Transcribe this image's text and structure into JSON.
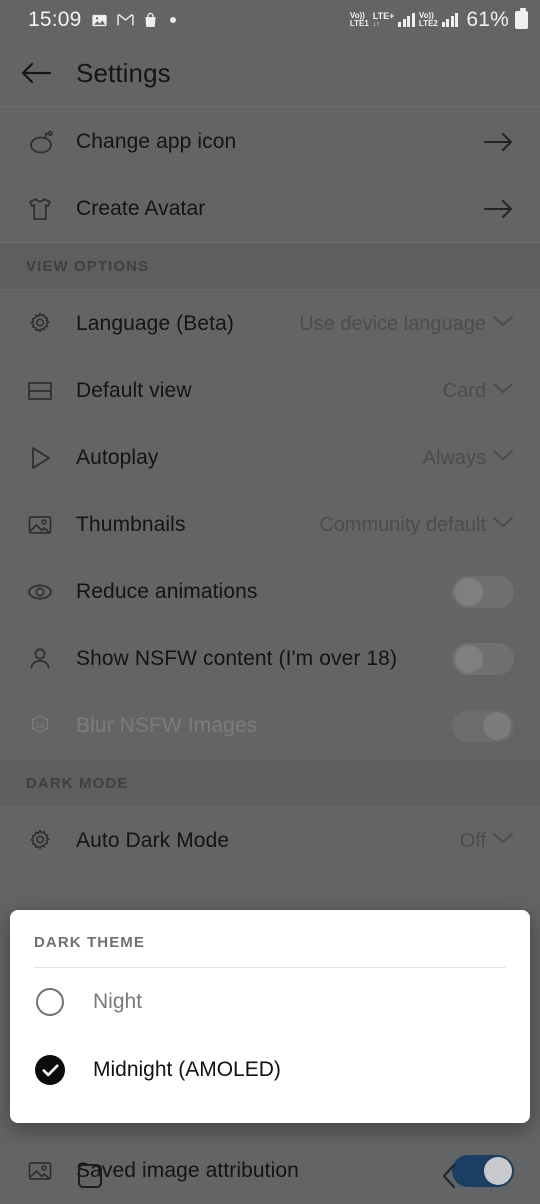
{
  "status_bar": {
    "clock": "15:09",
    "icons": [
      "photos-icon",
      "gmail-icon",
      "shopping-bag-icon",
      "dot-icon"
    ],
    "network": {
      "volte1_line1": "Vo))",
      "volte1_line2": "LTE1",
      "lte_plus": "LTE+",
      "data_arrows": "↓↑",
      "volte2_line1": "Vo))",
      "volte2_line2": "LTE2"
    },
    "battery_percent": "61%"
  },
  "app_bar": {
    "title": "Settings",
    "back_icon": "back-arrow-icon"
  },
  "settings": {
    "top_rows": [
      {
        "icon": "reddit-snoo-icon",
        "label": "Change app icon",
        "trailing": "arrow-right-icon"
      },
      {
        "icon": "tshirt-icon",
        "label": "Create Avatar",
        "trailing": "arrow-right-icon"
      }
    ],
    "view_options": {
      "header": "VIEW OPTIONS",
      "rows": [
        {
          "icon": "gear-icon",
          "label": "Language (Beta)",
          "value": "Use device language",
          "control": "dropdown"
        },
        {
          "icon": "card-view-icon",
          "label": "Default view",
          "value": "Card",
          "control": "dropdown"
        },
        {
          "icon": "play-icon",
          "label": "Autoplay",
          "value": "Always",
          "control": "dropdown"
        },
        {
          "icon": "image-icon",
          "label": "Thumbnails",
          "value": "Community default",
          "control": "dropdown"
        },
        {
          "icon": "eye-icon",
          "label": "Reduce animations",
          "value": "",
          "control": "toggle-off"
        },
        {
          "icon": "person-icon",
          "label": "Show NSFW content (I'm over 18)",
          "value": "",
          "control": "toggle-off"
        },
        {
          "icon": "age-18-icon",
          "label": "Blur NSFW Images",
          "value": "",
          "control": "toggle-on-disabled"
        }
      ]
    },
    "dark_mode": {
      "header": "DARK MODE",
      "rows": [
        {
          "icon": "gear-icon",
          "label": "Auto Dark Mode",
          "value": "Off",
          "control": "dropdown"
        }
      ]
    },
    "bottom_row": {
      "icon": "image-icon",
      "label": "Saved image attribution",
      "control": "toggle-on",
      "toggle_color": "#1b3e63"
    }
  },
  "dialog": {
    "title": "DARK THEME",
    "options": [
      {
        "label": "Night",
        "selected": false
      },
      {
        "label": "Midnight (AMOLED)",
        "selected": true
      }
    ]
  },
  "nav_bar": {
    "back_label": "back-chevron-icon",
    "recents_label": "recents-square-icon"
  }
}
